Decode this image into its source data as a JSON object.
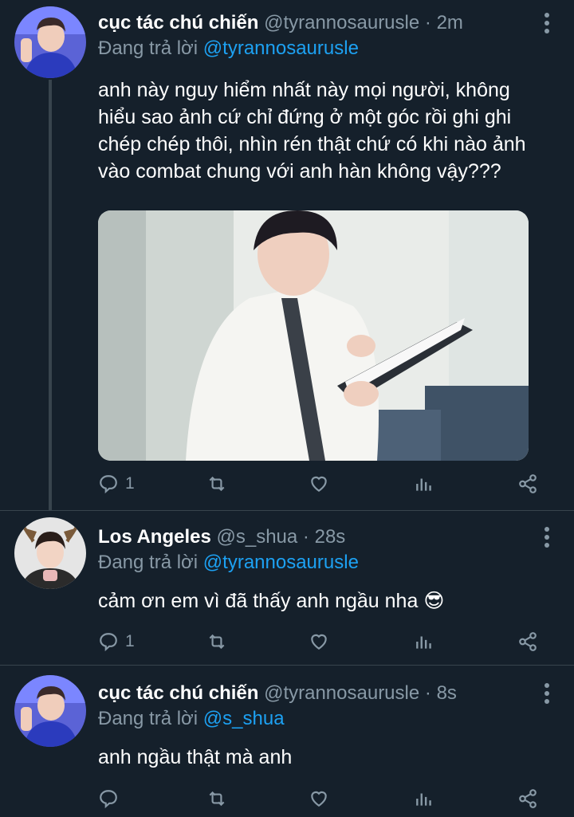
{
  "colors": {
    "background": "#15202b",
    "accent": "#1da1f2",
    "muted": "#8899a6",
    "divider": "#38444d"
  },
  "tweets": [
    {
      "name": "cục tác chú chiến",
      "handle": "@tyrannosaurusle",
      "separator": "·",
      "time": "2m",
      "reply_prefix": "Đang trả lời",
      "reply_to": "@tyrannosaurusle",
      "text": "anh này nguy hiểm nhất này mọi người, không hiểu sao ảnh cứ chỉ đứng ở một góc rồi ghi ghi chép chép thôi, nhìn rén thật chứ có khi nào ảnh vào combat chung với anh hàn không vậy???",
      "reply_count": "1"
    },
    {
      "name": "Los Angeles",
      "handle": "@s_shua",
      "separator": "·",
      "time": "28s",
      "reply_prefix": "Đang trả lời",
      "reply_to": "@tyrannosaurusle",
      "text": "cảm ơn em vì đã thấy anh ngầu nha 😎",
      "reply_count": "1"
    },
    {
      "name": "cục tác chú chiến",
      "handle": "@tyrannosaurusle",
      "separator": "·",
      "time": "8s",
      "reply_prefix": "Đang trả lời",
      "reply_to": "@s_shua",
      "text": "anh ngầu thật mà anh",
      "reply_count": ""
    }
  ],
  "icons": [
    "reply-icon",
    "retweet-icon",
    "like-icon",
    "stats-icon",
    "share-icon",
    "more-options-icon"
  ]
}
